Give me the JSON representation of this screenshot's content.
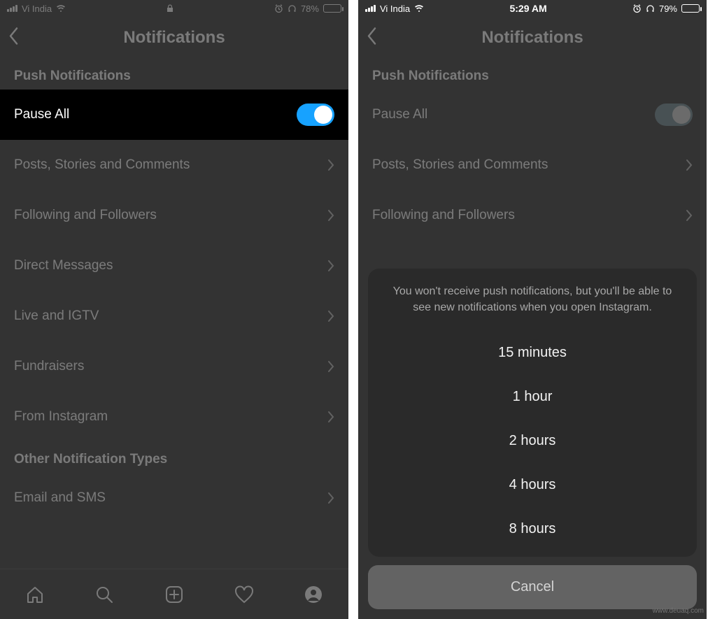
{
  "left": {
    "status": {
      "carrier": "Vi India",
      "battery_pct": "78%",
      "battery_fill_width": "78%"
    },
    "nav": {
      "title": "Notifications"
    },
    "section1_label": "Push Notifications",
    "pause_all_label": "Pause All",
    "rows": [
      "Posts, Stories and Comments",
      "Following and Followers",
      "Direct Messages",
      "Live and IGTV",
      "Fundraisers",
      "From Instagram"
    ],
    "section2_label": "Other Notification Types",
    "email_sms_label": "Email and SMS"
  },
  "right": {
    "status": {
      "carrier": "Vi India",
      "time": "5:29 AM",
      "battery_pct": "79%",
      "battery_fill_width": "79%"
    },
    "nav": {
      "title": "Notifications"
    },
    "section1_label": "Push Notifications",
    "pause_all_label": "Pause All",
    "rows": [
      "Posts, Stories and Comments",
      "Following and Followers"
    ],
    "sheet": {
      "message": "You won't receive push notifications, but you'll be able to see new notifications when you open Instagram.",
      "options": [
        "15 minutes",
        "1 hour",
        "2 hours",
        "4 hours",
        "8 hours"
      ],
      "cancel": "Cancel"
    }
  },
  "watermark": "www.deuaq.com"
}
